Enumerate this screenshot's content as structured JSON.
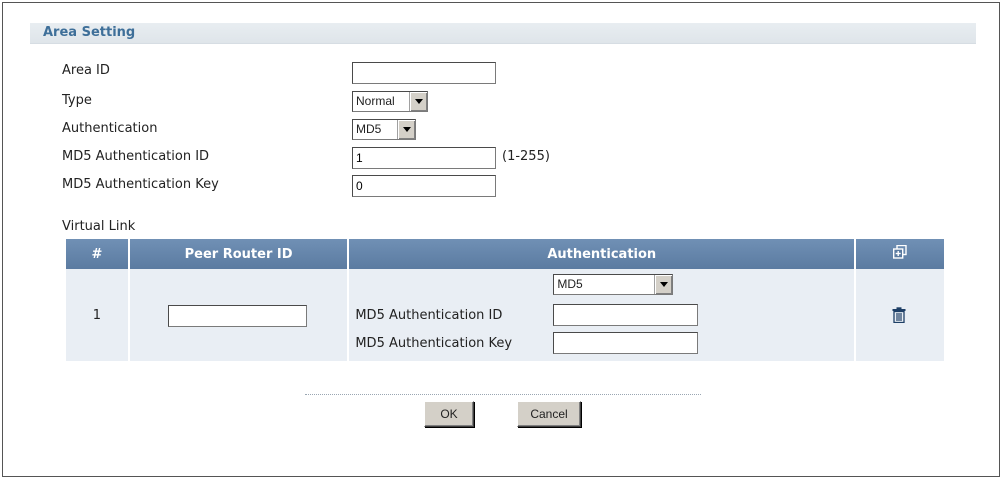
{
  "section": {
    "title": "Area Setting"
  },
  "form": {
    "area_id": {
      "label": "Area ID",
      "value": ""
    },
    "type": {
      "label": "Type",
      "selected": "Normal"
    },
    "authentication": {
      "label": "Authentication",
      "selected": "MD5"
    },
    "md5_auth_id": {
      "label": "MD5 Authentication ID",
      "value": "1",
      "hint": "(1-255)"
    },
    "md5_auth_key": {
      "label": "MD5 Authentication Key",
      "value": "0"
    }
  },
  "virtual_link": {
    "title": "Virtual Link",
    "columns": [
      "#",
      "Peer Router ID",
      "Authentication"
    ],
    "rows": [
      {
        "num": "1",
        "peer_router_id": "",
        "auth_selected": "MD5",
        "md5_auth_id_label": "MD5 Authentication ID",
        "md5_auth_id_value": "",
        "md5_auth_key_label": "MD5 Authentication Key",
        "md5_auth_key_value": ""
      }
    ]
  },
  "icons": {
    "add": "add-row-icon",
    "delete": "trash-icon"
  },
  "buttons": {
    "ok": "OK",
    "cancel": "Cancel"
  },
  "colors": {
    "section_title": "#3e6f99",
    "table_header": "#6485ab",
    "row_bg": "#e9eef4"
  }
}
